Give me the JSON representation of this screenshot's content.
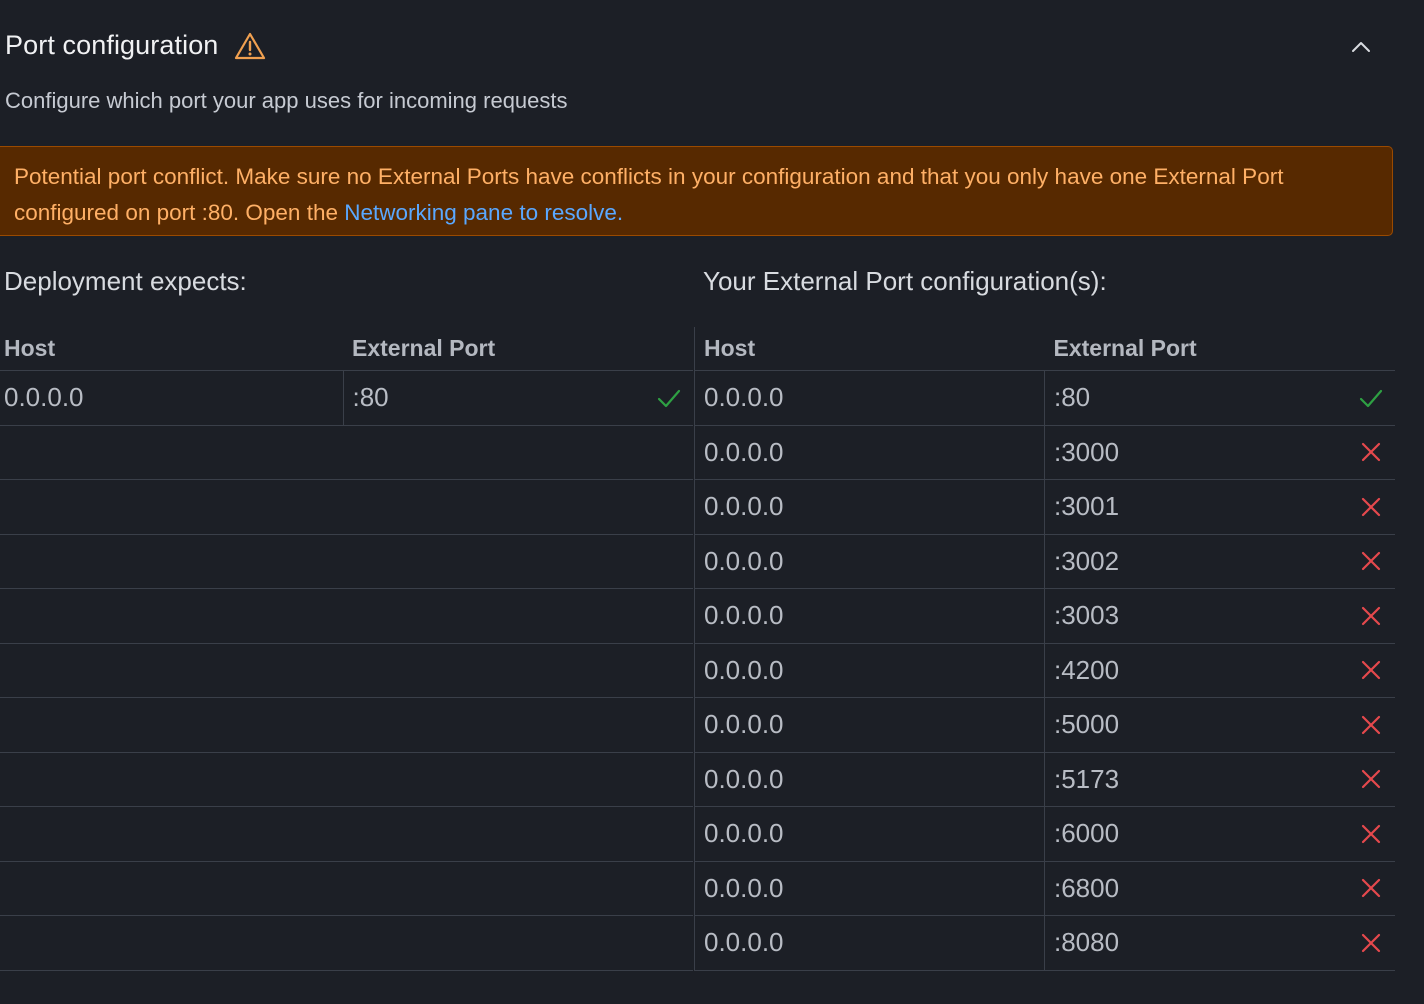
{
  "section": {
    "title": "Port configuration",
    "subtitle": "Configure which port your app uses for incoming requests",
    "warning_icon": "warning-triangle-icon",
    "collapse_icon": "chevron-up-icon"
  },
  "alert": {
    "text": "Potential port conflict. Make sure no External Ports have conflicts in your configuration and that you only have one External Port configured on port :80. Open the ",
    "link_text": "Networking pane to resolve."
  },
  "deployment": {
    "label": "Deployment expects:",
    "headers": {
      "host": "Host",
      "port": "External Port"
    },
    "rows": [
      {
        "host": "0.0.0.0",
        "port": ":80",
        "status": "ok"
      }
    ]
  },
  "external": {
    "label": "Your External Port configuration(s):",
    "headers": {
      "host": "Host",
      "port": "External Port"
    },
    "rows": [
      {
        "host": "0.0.0.0",
        "port": ":80",
        "status": "ok"
      },
      {
        "host": "0.0.0.0",
        "port": ":3000",
        "status": "conflict"
      },
      {
        "host": "0.0.0.0",
        "port": ":3001",
        "status": "conflict"
      },
      {
        "host": "0.0.0.0",
        "port": ":3002",
        "status": "conflict"
      },
      {
        "host": "0.0.0.0",
        "port": ":3003",
        "status": "conflict"
      },
      {
        "host": "0.0.0.0",
        "port": ":4200",
        "status": "conflict"
      },
      {
        "host": "0.0.0.0",
        "port": ":5000",
        "status": "conflict"
      },
      {
        "host": "0.0.0.0",
        "port": ":5173",
        "status": "conflict"
      },
      {
        "host": "0.0.0.0",
        "port": ":6000",
        "status": "conflict"
      },
      {
        "host": "0.0.0.0",
        "port": ":6800",
        "status": "conflict"
      },
      {
        "host": "0.0.0.0",
        "port": ":8080",
        "status": "conflict"
      }
    ]
  },
  "colors": {
    "background": "#1c1f26",
    "alert_bg": "#572900",
    "alert_text": "#ffb066",
    "link": "#5aa8ff",
    "ok": "#2ea043",
    "conflict": "#e5484d",
    "warning": "#f0a050"
  }
}
